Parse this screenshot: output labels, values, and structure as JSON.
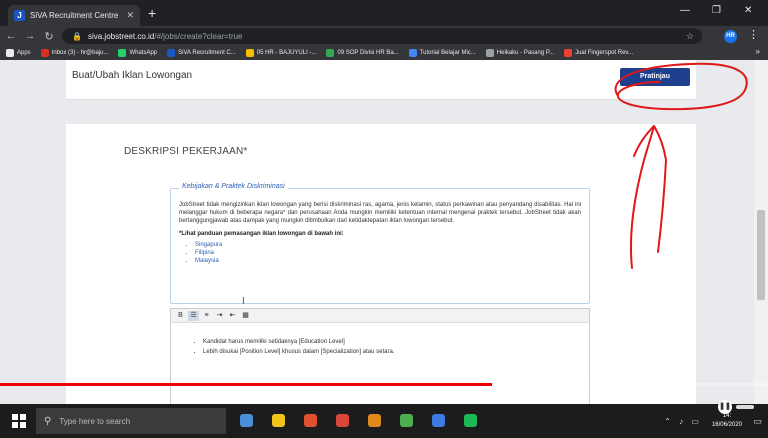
{
  "browser": {
    "tab_title": "SiVA Recruitment Centre",
    "url_host": "siva.jobstreet.co.id",
    "url_path": "/#/jobs/create?clear=true",
    "profile_initials": "HR",
    "bookmarks": [
      {
        "label": "Apps",
        "color": "#e8eaed"
      },
      {
        "label": "Inbox (3) - hr@baju...",
        "color": "#d93025"
      },
      {
        "label": "WhatsApp",
        "color": "#25d366"
      },
      {
        "label": "SiVA Recruitment C...",
        "color": "#1a56c4"
      },
      {
        "label": "05 HR - BAJUYULI -...",
        "color": "#fbbc04"
      },
      {
        "label": "09 SOP Divisi HR Ba...",
        "color": "#34a853"
      },
      {
        "label": "Tutorial Belajar Mic...",
        "color": "#4285f4"
      },
      {
        "label": "Heikaku - Pasang P...",
        "color": "#9aa0a6"
      },
      {
        "label": "Jual Fingerspot Rev...",
        "color": "#ea4335"
      }
    ]
  },
  "page": {
    "title": "Buat/Ubah Iklan Lowongan",
    "preview_label": "Pratinjau",
    "section_title": "DESKRIPSI PEKERJAAN*",
    "policy": {
      "legend": "Kebijakan & Praktek Diskriminasi",
      "text": "JobStreet tidak mengizinkan iklan lowongan yang berisi diskriminasi ras, agama, jenis kelamin, status perkawinan atau penyandang disabilitas. Hal ini melanggar hukum di beberapa negara* dan perusahaan Anda mungkin memiliki ketentuan internal mengenai praktek tersebut. JobStreet tidak akan bertanggungjawab atas dampak yang mungkin ditimbulkan dari ketidaktepatan iklan lowongan tersebut.",
      "guide": "*Lihat panduan pemasangan iklan lowongan di bawah ini:",
      "countries": [
        "Singapura",
        "Filipina",
        "Malaysia"
      ]
    },
    "editor": {
      "toolbar": [
        {
          "glyph": "B",
          "name": "bold-button"
        },
        {
          "glyph": "☰",
          "name": "bullet-list-button"
        },
        {
          "glyph": "≡",
          "name": "numbered-list-button"
        },
        {
          "glyph": "⇥",
          "name": "indent-button"
        },
        {
          "glyph": "⇤",
          "name": "outdent-button"
        },
        {
          "glyph": "▦",
          "name": "table-button"
        }
      ],
      "items": [
        "Kandidat harus memiliki setidaknya [Education Level]",
        "Lebih disukai [Position Level] khusus dalam [Specialization] atau setara."
      ]
    }
  },
  "video": {
    "progress_percent": 64
  },
  "taskbar": {
    "search_placeholder": "Type here to search",
    "time": "14:",
    "date": "16/06/2020",
    "app_colors": [
      "#4a90d9",
      "#f0c419",
      "#e04f2f",
      "#d9463a",
      "#e08a1e",
      "#4caf50",
      "#3d7be0",
      "#1db954"
    ]
  }
}
